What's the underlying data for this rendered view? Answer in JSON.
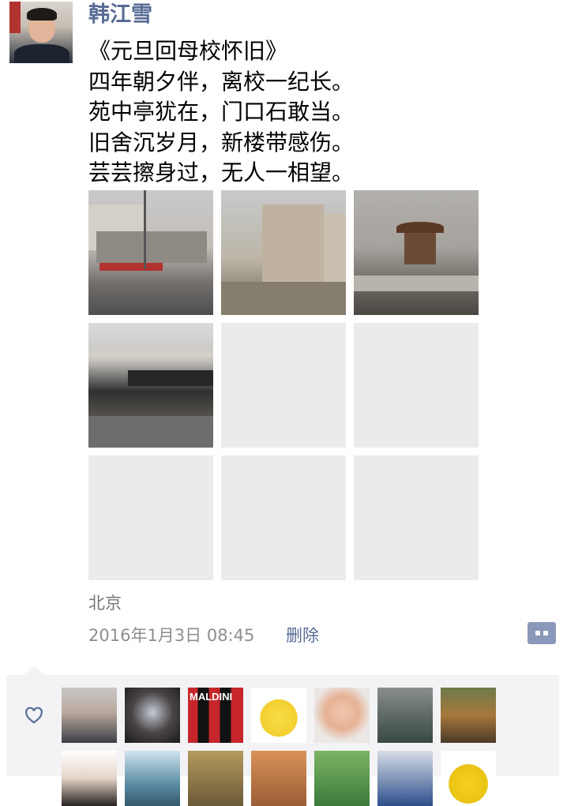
{
  "post": {
    "author": "韩江雪",
    "lines": [
      "《元旦回母校怀旧》",
      "四年朝夕伴，离校一纪长。",
      "苑中亭犹在，门口石敢当。",
      "旧舍沉岁月，新楼带感伤。",
      "芸芸擦身过，无人一相望。"
    ],
    "location": "北京",
    "timestamp": "2016年1月3日 08:45",
    "delete_label": "删除"
  },
  "photos": [
    {
      "name": "photo-gate-street",
      "loaded": true
    },
    {
      "name": "photo-tall-building",
      "loaded": true
    },
    {
      "name": "photo-pavilion-lake",
      "loaded": true
    },
    {
      "name": "photo-old-dormitory",
      "loaded": true
    },
    {
      "name": "photo-placeholder-5",
      "loaded": false
    },
    {
      "name": "photo-placeholder-6",
      "loaded": false
    },
    {
      "name": "photo-placeholder-7",
      "loaded": false
    },
    {
      "name": "photo-placeholder-8",
      "loaded": false
    },
    {
      "name": "photo-placeholder-9",
      "loaded": false
    }
  ],
  "likes": {
    "icon": "heart-outline-icon",
    "avatars": [
      "man-glasses",
      "dark-figure",
      "maldini-3",
      "yellow-chick",
      "baby-boy",
      "plants-pot",
      "person-bridge",
      "woman-face",
      "umbrella",
      "helmet",
      "orange-field",
      "tree-path",
      "person-blue",
      "minion"
    ],
    "overlay_text": "MALDINI"
  },
  "colors": {
    "link": "#576b95",
    "placeholder": "#ebebe9",
    "likes_bg": "#f3f3f5"
  }
}
